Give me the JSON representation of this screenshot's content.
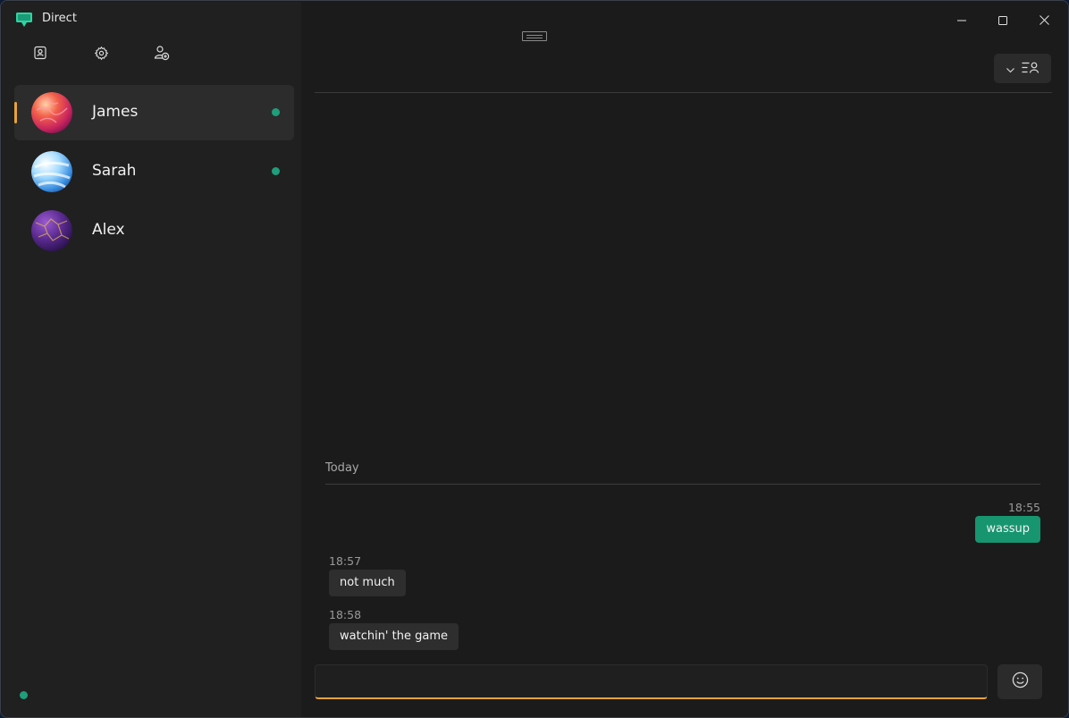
{
  "app": {
    "title": "Direct",
    "accent": "#e8a33a",
    "online_color": "#1e9e7a",
    "outgoing_bubble": "#17956f"
  },
  "toolbar": {
    "icons": [
      "profile-card-icon",
      "gear-icon",
      "add-contact-icon"
    ]
  },
  "contacts": [
    {
      "name": "James",
      "online": true,
      "selected": true,
      "avatar": "red-orb"
    },
    {
      "name": "Sarah",
      "online": true,
      "selected": false,
      "avatar": "blue-orb"
    },
    {
      "name": "Alex",
      "online": false,
      "selected": false,
      "avatar": "purple-orb"
    }
  ],
  "window_controls": [
    "minimize-icon",
    "maximize-icon",
    "close-icon"
  ],
  "chat": {
    "date_separator": "Today",
    "messages": [
      {
        "time": "18:55",
        "text": "wassup",
        "direction": "outgoing"
      },
      {
        "time": "18:57",
        "text": "not much",
        "direction": "incoming"
      },
      {
        "time": "18:58",
        "text": "watchin' the game",
        "direction": "incoming"
      }
    ]
  },
  "composer": {
    "value": "",
    "placeholder": ""
  }
}
